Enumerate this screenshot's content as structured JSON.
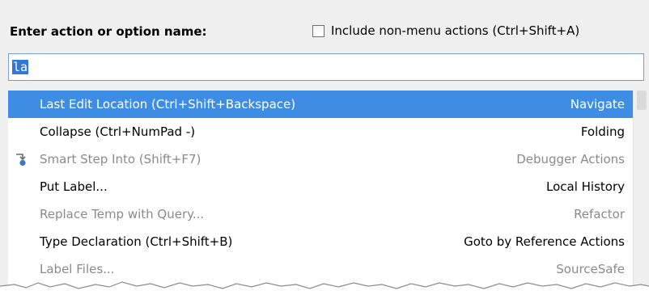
{
  "prompt": {
    "label": "Enter action or option name:"
  },
  "include_option": {
    "label": "Include non-menu actions (Ctrl+Shift+A)",
    "checked": false
  },
  "search": {
    "value": "la"
  },
  "results": [
    {
      "label": "Last Edit Location (Ctrl+Shift+Backspace)",
      "group": "Navigate",
      "selected": true,
      "disabled": false,
      "icon": ""
    },
    {
      "label": "Collapse (Ctrl+NumPad -)",
      "group": "Folding",
      "selected": false,
      "disabled": false,
      "icon": ""
    },
    {
      "label": "Smart Step Into (Shift+F7)",
      "group": "Debugger Actions",
      "selected": false,
      "disabled": true,
      "icon": "smart-step-into-icon"
    },
    {
      "label": "Put Label...",
      "group": "Local History",
      "selected": false,
      "disabled": false,
      "icon": ""
    },
    {
      "label": "Replace Temp with Query...",
      "group": "Refactor",
      "selected": false,
      "disabled": true,
      "icon": ""
    },
    {
      "label": "Type Declaration (Ctrl+Shift+B)",
      "group": "Goto by Reference Actions",
      "selected": false,
      "disabled": false,
      "icon": ""
    },
    {
      "label": "Label Files...",
      "group": "SourceSafe",
      "selected": false,
      "disabled": true,
      "icon": ""
    }
  ],
  "colors": {
    "selection": "#3e8de4",
    "disabled_text": "#8a8a8a",
    "search_highlight": "#3377d6",
    "background": "#f0f0f0"
  }
}
